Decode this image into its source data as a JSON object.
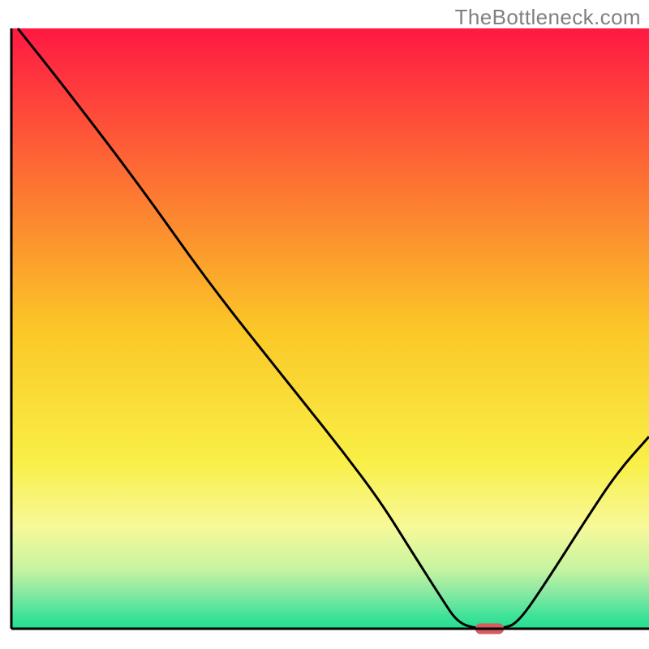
{
  "watermark": "TheBottleneck.com",
  "chart_data": {
    "type": "line",
    "title": "",
    "xlabel": "",
    "ylabel": "",
    "xlim": [
      0,
      100
    ],
    "ylim": [
      0,
      100
    ],
    "legend": null,
    "grid": false,
    "annotations": [],
    "background_gradient_stops": [
      {
        "offset": 0.0,
        "color": "#ff1843"
      },
      {
        "offset": 0.25,
        "color": "#fd7033"
      },
      {
        "offset": 0.5,
        "color": "#fbc727"
      },
      {
        "offset": 0.72,
        "color": "#f9ef46"
      },
      {
        "offset": 0.83,
        "color": "#f7f999"
      },
      {
        "offset": 0.9,
        "color": "#c7f4a0"
      },
      {
        "offset": 0.94,
        "color": "#88e9a3"
      },
      {
        "offset": 0.98,
        "color": "#3de298"
      },
      {
        "offset": 1.0,
        "color": "#24de8f"
      }
    ],
    "curve_points_xy": [
      [
        1.0,
        100.0
      ],
      [
        7.0,
        92.0
      ],
      [
        15.0,
        81.0
      ],
      [
        22.0,
        71.0
      ],
      [
        28.0,
        62.0
      ],
      [
        34.0,
        53.5
      ],
      [
        40.0,
        45.5
      ],
      [
        46.0,
        37.5
      ],
      [
        52.0,
        29.5
      ],
      [
        58.0,
        21.0
      ],
      [
        63.0,
        12.5
      ],
      [
        67.5,
        5.0
      ],
      [
        70.0,
        1.0
      ],
      [
        73.0,
        0.0
      ],
      [
        77.0,
        0.0
      ],
      [
        79.5,
        1.0
      ],
      [
        84.0,
        8.0
      ],
      [
        90.0,
        18.0
      ],
      [
        95.0,
        26.0
      ],
      [
        100.0,
        32.0
      ]
    ],
    "marker": {
      "shape": "rounded-rect",
      "x_center": 75.0,
      "y_center": 0.0,
      "width": 4.5,
      "height": 1.8,
      "color": "#d85a60"
    },
    "axis_line_x": {
      "y": 0,
      "x0": 0,
      "x1": 100,
      "color": "#000000",
      "width": 3
    },
    "axis_line_y": {
      "x": 0,
      "y0": 0,
      "y1": 100,
      "color": "#000000",
      "width": 3
    }
  }
}
